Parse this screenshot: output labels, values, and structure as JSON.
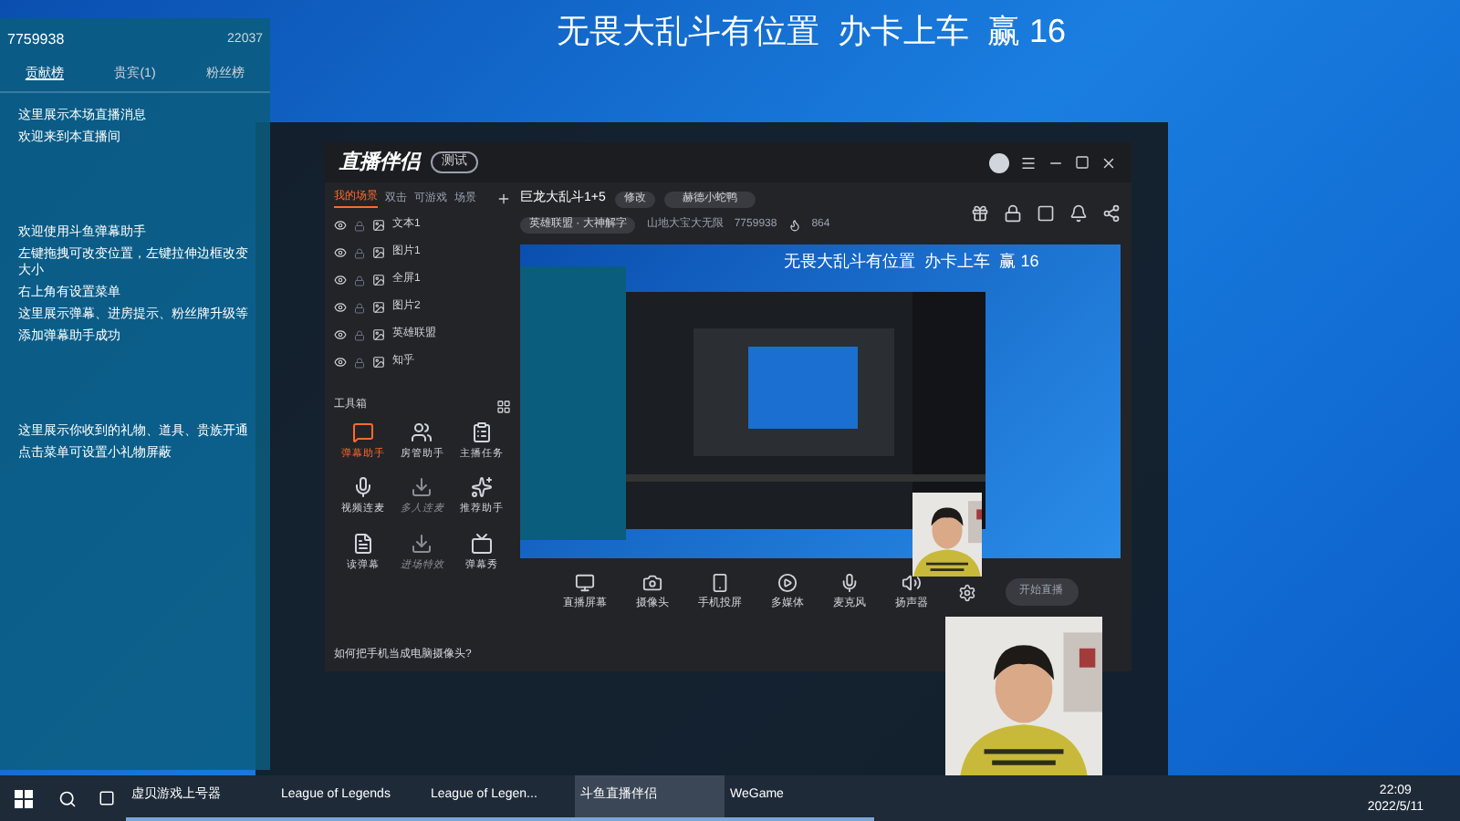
{
  "stream_title": "无畏大乱斗有位置  办卡上车  赢 16",
  "chat_panel": {
    "room_id": "7759938",
    "count": "22037",
    "tabs": [
      {
        "label": "贡献榜",
        "selected": true
      },
      {
        "label": "贵宾(1)",
        "selected": false
      },
      {
        "label": "粉丝榜",
        "selected": false
      }
    ],
    "messages": [
      {
        "text": "这里展示本场直播消息"
      },
      {
        "text": "欢迎来到本直播间"
      },
      {
        "text": "欢迎使用斗鱼弹幕助手"
      },
      {
        "text": "左键拖拽可改变位置，左键拉伸边框改变大小"
      },
      {
        "text": "右上角有设置菜单"
      },
      {
        "text": "这里展示弹幕、进房提示、粉丝牌升级等"
      },
      {
        "text": "添加弹幕助手成功"
      },
      {
        "text": "这里展示你收到的礼物、道具、贵族开通"
      },
      {
        "text": "点击菜单可设置小礼物屏蔽"
      }
    ]
  },
  "app": {
    "name": "直播伴侣",
    "badge": "测试",
    "scene_tabs": [
      {
        "label": "我的场景",
        "selected": true
      },
      {
        "label": "双击",
        "selected": false
      },
      {
        "label": "可游戏",
        "selected": false
      },
      {
        "label": "场景",
        "selected": false
      }
    ],
    "scenes": [
      "文本1",
      "图片1",
      "全屏1",
      "图片2",
      "英雄联盟",
      "知乎"
    ],
    "toolbox_title": "工具箱",
    "tools": [
      {
        "label": "弹幕助手",
        "disabled": false,
        "selected": true
      },
      {
        "label": "房管助手",
        "disabled": false,
        "selected": false
      },
      {
        "label": "主播任务",
        "disabled": false,
        "selected": false
      },
      {
        "label": "视频连麦",
        "disabled": false,
        "selected": false
      },
      {
        "label": "多人连麦",
        "disabled": true,
        "selected": false
      },
      {
        "label": "推荐助手",
        "disabled": false,
        "selected": false
      },
      {
        "label": "读弹幕",
        "disabled": false,
        "selected": false
      },
      {
        "label": "进场特效",
        "disabled": true,
        "selected": false
      },
      {
        "label": "弹幕秀",
        "disabled": false,
        "selected": false
      }
    ],
    "tip": "如何把手机当成电脑摄像头?",
    "room_title": "巨龙大乱斗1+5",
    "edit_label": "修改",
    "anchor": "赫德小蛇鸭",
    "category": "英雄联盟 · 大神解字",
    "location": "山地大宝大无限",
    "room_number": "7759938",
    "viewers": "864",
    "preview_title": "无畏大乱斗有位置  办卡上车  赢 16",
    "sources": [
      "直播屏幕",
      "摄像头",
      "手机投屏",
      "多媒体",
      "麦克风",
      "扬声器"
    ],
    "start_button": "开始直播"
  },
  "taskbar": {
    "items": [
      {
        "label": "虚贝游戏上号器",
        "selected": false
      },
      {
        "label": "League of Legends",
        "selected": false
      },
      {
        "label": "League of Legen...",
        "selected": false
      },
      {
        "label": "斗鱼直播伴侣",
        "selected": true
      },
      {
        "label": "WeGame",
        "selected": false
      }
    ],
    "time": "22:09",
    "date": "2022/5/11"
  }
}
